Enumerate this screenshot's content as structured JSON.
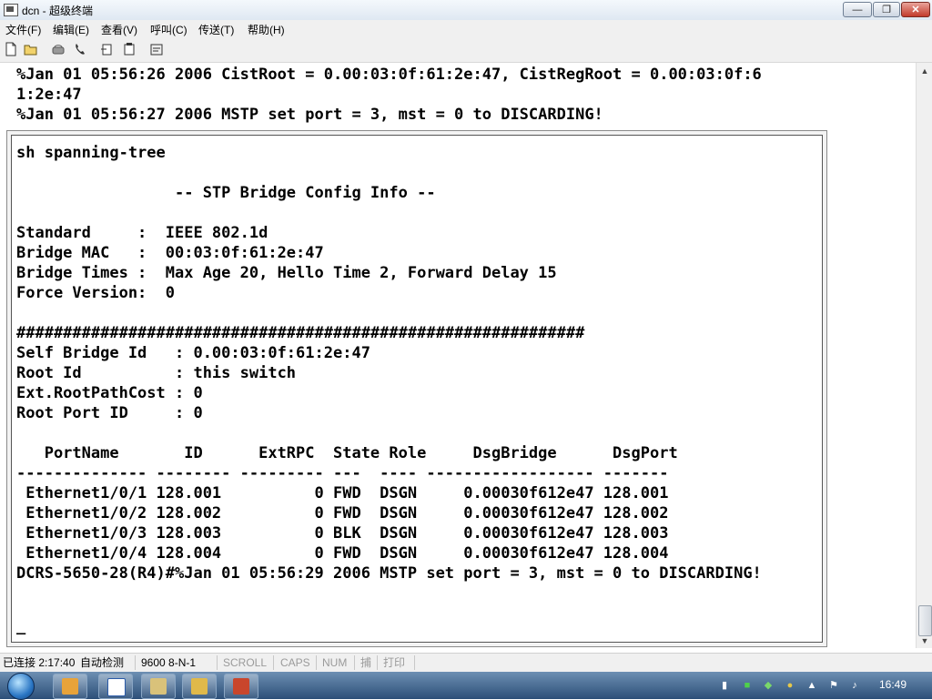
{
  "window": {
    "title": "dcn - 超级终端",
    "minimize_label": "—",
    "maximize_label": "❐",
    "close_label": "✕"
  },
  "menu": [
    "文件(F)",
    "编辑(E)",
    "查看(V)",
    "呼叫(C)",
    "传送(T)",
    "帮助(H)"
  ],
  "toolbar": {
    "icons": [
      "new-icon",
      "open-icon",
      "disconnect-icon",
      "call-icon",
      "send-icon",
      "receive-icon",
      "properties-icon"
    ]
  },
  "terminal": {
    "lines_top": [
      "%Jan 01 05:56:26 2006 CistRoot = 0.00:03:0f:61:2e:47, CistRegRoot = 0.00:03:0f:6",
      "1:2e:47",
      "%Jan 01 05:56:27 2006 MSTP set port = 3, mst = 0 to DISCARDING!"
    ],
    "lines_inner": [
      "sh spanning-tree",
      "",
      "                 -- STP Bridge Config Info --",
      "",
      "Standard     :  IEEE 802.1d",
      "Bridge MAC   :  00:03:0f:61:2e:47",
      "Bridge Times :  Max Age 20, Hello Time 2, Forward Delay 15",
      "Force Version:  0",
      "",
      "#############################################################",
      "Self Bridge Id   : 0.00:03:0f:61:2e:47",
      "Root Id          : this switch",
      "Ext.RootPathCost : 0",
      "Root Port ID     : 0",
      "",
      "   PortName       ID      ExtRPC  State Role     DsgBridge      DsgPort",
      "-------------- -------- --------- ---  ---- ------------------ -------",
      " Ethernet1/0/1 128.001          0 FWD  DSGN     0.00030f612e47 128.001",
      " Ethernet1/0/2 128.002          0 FWD  DSGN     0.00030f612e47 128.002",
      " Ethernet1/0/3 128.003          0 BLK  DSGN     0.00030f612e47 128.003",
      " Ethernet1/0/4 128.004          0 FWD  DSGN     0.00030f612e47 128.004",
      "DCRS-5650-28(R4)#%Jan 01 05:56:29 2006 MSTP set port = 3, mst = 0 to DISCARDING!",
      "",
      "",
      "_"
    ]
  },
  "statusbar": {
    "connection": "已连接 2:17:40",
    "detect": "自动检测",
    "baud": "9600 8-N-1",
    "scroll": "SCROLL",
    "caps": "CAPS",
    "num": "NUM",
    "capture": "捕",
    "print": "打印"
  },
  "taskbar": {
    "clock": "16:49"
  }
}
